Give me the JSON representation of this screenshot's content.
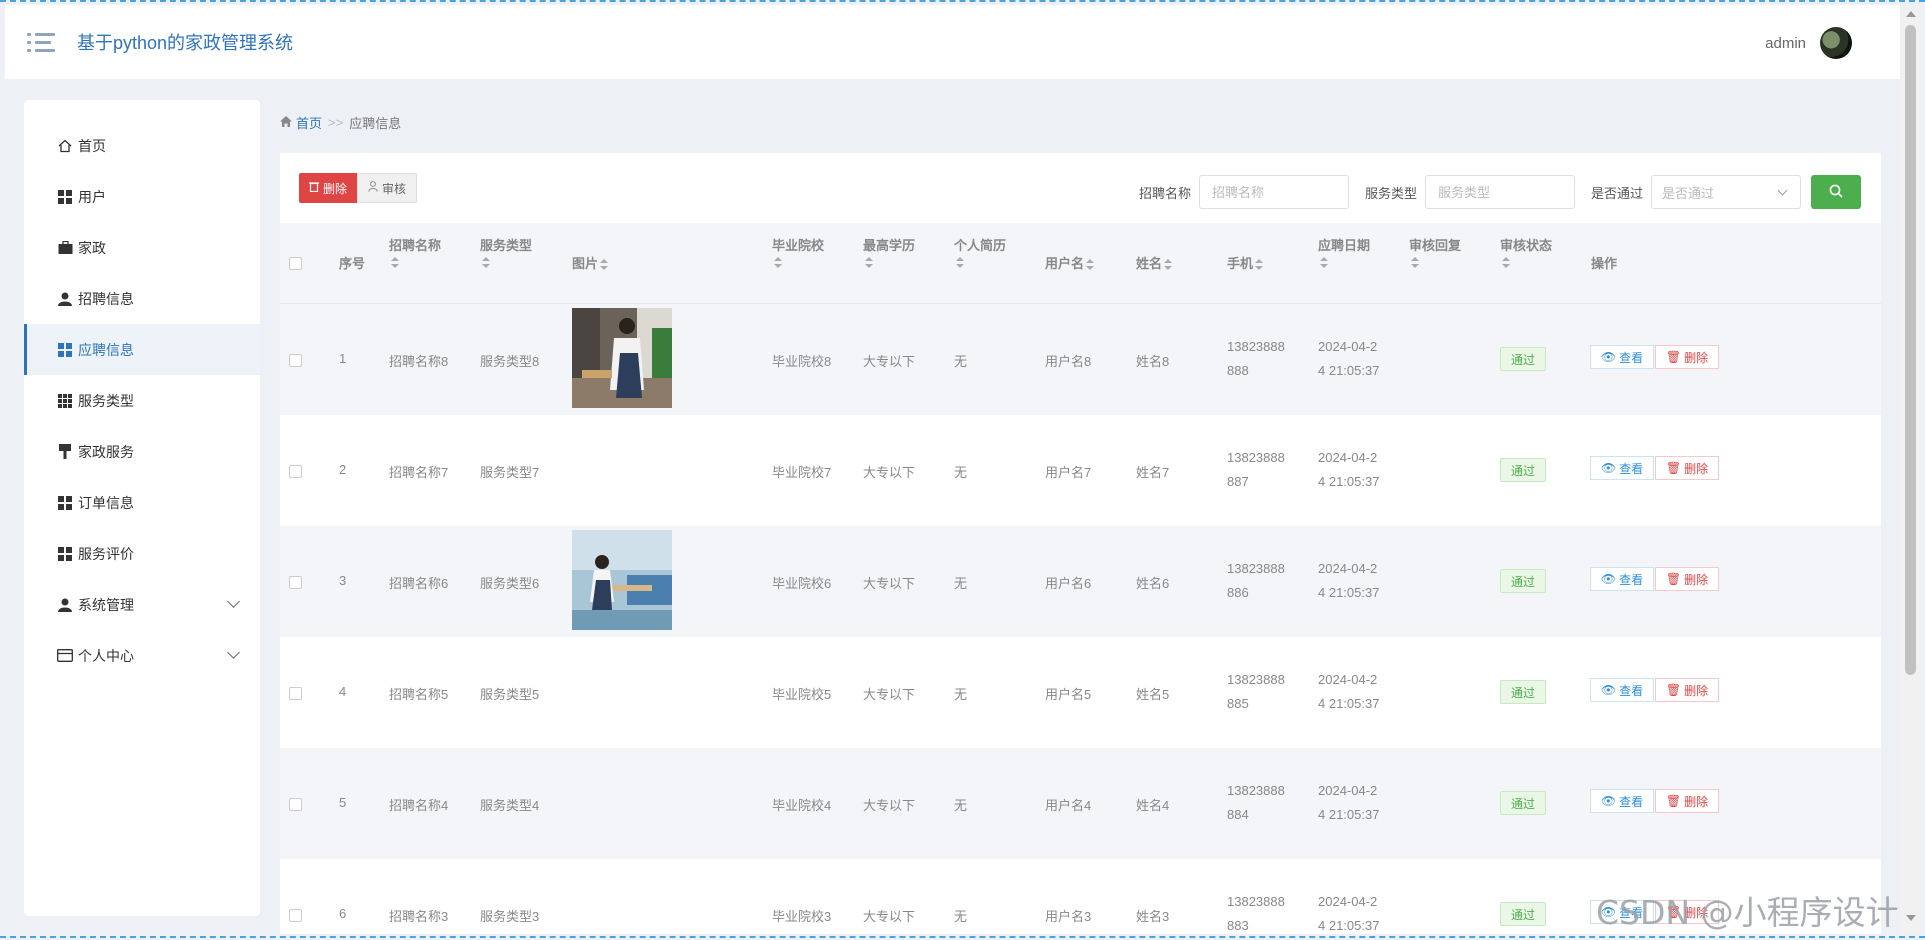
{
  "header": {
    "title": "基于python的家政管理系统",
    "user": "admin"
  },
  "sidebar": {
    "items": [
      {
        "label": "首页"
      },
      {
        "label": "用户"
      },
      {
        "label": "家政"
      },
      {
        "label": "招聘信息"
      },
      {
        "label": "应聘信息"
      },
      {
        "label": "服务类型"
      },
      {
        "label": "家政服务"
      },
      {
        "label": "订单信息"
      },
      {
        "label": "服务评价"
      },
      {
        "label": "系统管理"
      },
      {
        "label": "个人中心"
      }
    ]
  },
  "breadcrumb": {
    "home": "首页",
    "separator": ">>",
    "current": "应聘信息"
  },
  "toolbar": {
    "delete_label": "删除",
    "audit_label": "审核"
  },
  "filters": {
    "name_label": "招聘名称",
    "name_placeholder": "招聘名称",
    "type_label": "服务类型",
    "type_placeholder": "服务类型",
    "pass_label": "是否通过",
    "pass_placeholder": "是否通过"
  },
  "table": {
    "headers": {
      "index": "序号",
      "name": "招聘名称",
      "type": "服务类型",
      "image": "图片",
      "school": "毕业院校",
      "edu": "最高学历",
      "resume": "个人简历",
      "username": "用户名",
      "realname": "姓名",
      "phone": "手机",
      "date": "应聘日期",
      "reply": "审核回复",
      "status": "审核状态",
      "ops": "操作"
    },
    "view_label": "查看",
    "delete_label": "删除",
    "rows": [
      {
        "index": "1",
        "name": "招聘名称8",
        "type": "服务类型8",
        "school": "毕业院校8",
        "edu": "大专以下",
        "resume": "无",
        "username": "用户名8",
        "realname": "姓名8",
        "phone_a": "13823888",
        "phone_b": "888",
        "date_a": "2024-04-2",
        "date_b": "4 21:05:37",
        "status": "通过"
      },
      {
        "index": "2",
        "name": "招聘名称7",
        "type": "服务类型7",
        "school": "毕业院校7",
        "edu": "大专以下",
        "resume": "无",
        "username": "用户名7",
        "realname": "姓名7",
        "phone_a": "13823888",
        "phone_b": "887",
        "date_a": "2024-04-2",
        "date_b": "4 21:05:37",
        "status": "通过"
      },
      {
        "index": "3",
        "name": "招聘名称6",
        "type": "服务类型6",
        "school": "毕业院校6",
        "edu": "大专以下",
        "resume": "无",
        "username": "用户名6",
        "realname": "姓名6",
        "phone_a": "13823888",
        "phone_b": "886",
        "date_a": "2024-04-2",
        "date_b": "4 21:05:37",
        "status": "通过"
      },
      {
        "index": "4",
        "name": "招聘名称5",
        "type": "服务类型5",
        "school": "毕业院校5",
        "edu": "大专以下",
        "resume": "无",
        "username": "用户名5",
        "realname": "姓名5",
        "phone_a": "13823888",
        "phone_b": "885",
        "date_a": "2024-04-2",
        "date_b": "4 21:05:37",
        "status": "通过"
      },
      {
        "index": "5",
        "name": "招聘名称4",
        "type": "服务类型4",
        "school": "毕业院校4",
        "edu": "大专以下",
        "resume": "无",
        "username": "用户名4",
        "realname": "姓名4",
        "phone_a": "13823888",
        "phone_b": "884",
        "date_a": "2024-04-2",
        "date_b": "4 21:05:37",
        "status": "通过"
      },
      {
        "index": "6",
        "name": "招聘名称3",
        "type": "服务类型3",
        "school": "毕业院校3",
        "edu": "大专以下",
        "resume": "无",
        "username": "用户名3",
        "realname": "姓名3",
        "phone_a": "13823888",
        "phone_b": "883",
        "date_a": "2024-04-2",
        "date_b": "4 21:05:37",
        "status": "通过"
      }
    ]
  },
  "watermark": "CSDN @小程序设计"
}
